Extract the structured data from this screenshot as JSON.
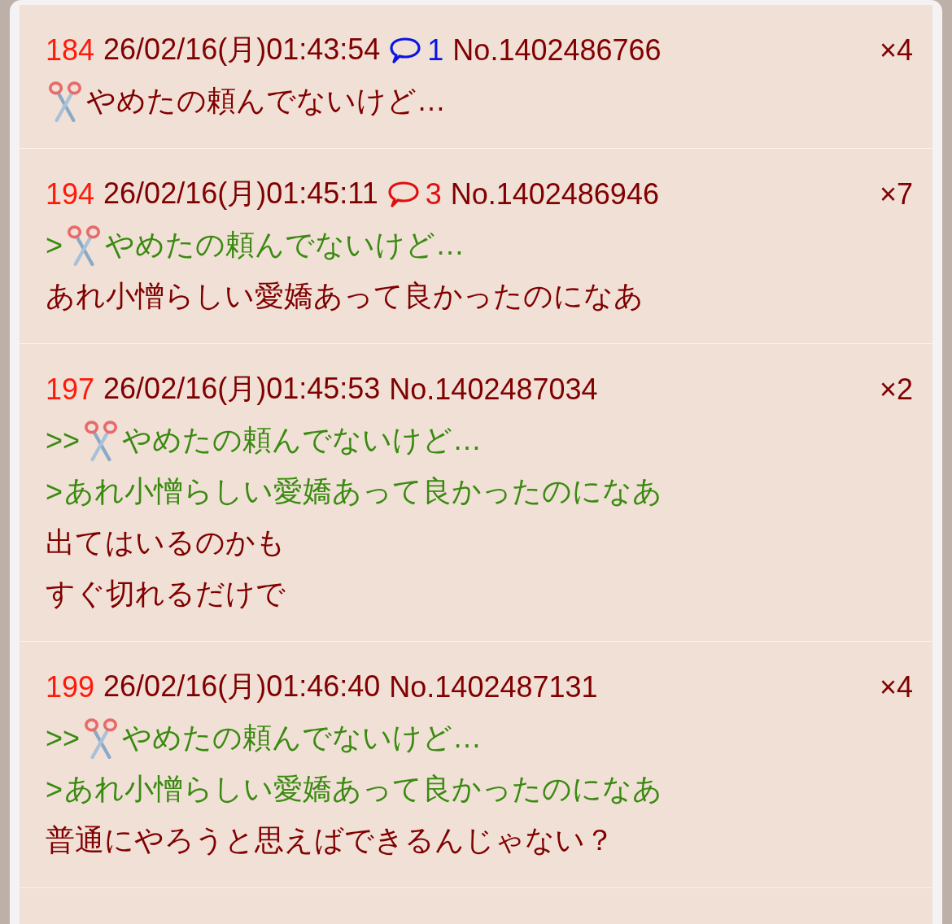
{
  "posts": [
    {
      "number": "184",
      "date": "26/02/16(月)01:43:54",
      "replies": {
        "count": "1",
        "color": "#0a14e6"
      },
      "post_no": "No.1402486766",
      "likes": "×4",
      "lines": [
        {
          "kind": "body",
          "scissors": true,
          "text": "やめたの頼んでないけど…"
        }
      ]
    },
    {
      "number": "194",
      "date": "26/02/16(月)01:45:11",
      "replies": {
        "count": "3",
        "color": "#e01010"
      },
      "post_no": "No.1402486946",
      "likes": "×7",
      "lines": [
        {
          "kind": "quote",
          "prefix": ">",
          "scissors": true,
          "text": "やめたの頼んでないけど…"
        },
        {
          "kind": "body",
          "scissors": false,
          "text": "あれ小憎らしい愛嬌あって良かったのになあ"
        }
      ]
    },
    {
      "number": "197",
      "date": "26/02/16(月)01:45:53",
      "post_no": "No.1402487034",
      "likes": "×2",
      "lines": [
        {
          "kind": "quote",
          "prefix": ">>",
          "scissors": true,
          "text": "やめたの頼んでないけど…"
        },
        {
          "kind": "quote",
          "prefix": ">",
          "scissors": false,
          "text": "あれ小憎らしい愛嬌あって良かったのになあ"
        },
        {
          "kind": "body",
          "scissors": false,
          "text": "出てはいるのかも"
        },
        {
          "kind": "body",
          "scissors": false,
          "text": "すぐ切れるだけで"
        }
      ]
    },
    {
      "number": "199",
      "date": "26/02/16(月)01:46:40",
      "post_no": "No.1402487131",
      "likes": "×4",
      "lines": [
        {
          "kind": "quote",
          "prefix": ">>",
          "scissors": true,
          "text": "やめたの頼んでないけど…"
        },
        {
          "kind": "quote",
          "prefix": ">",
          "scissors": false,
          "text": "あれ小憎らしい愛嬌あって良かったのになあ"
        },
        {
          "kind": "body",
          "scissors": false,
          "text": "普通にやろうと思えばできるんじゃない？"
        }
      ]
    }
  ]
}
